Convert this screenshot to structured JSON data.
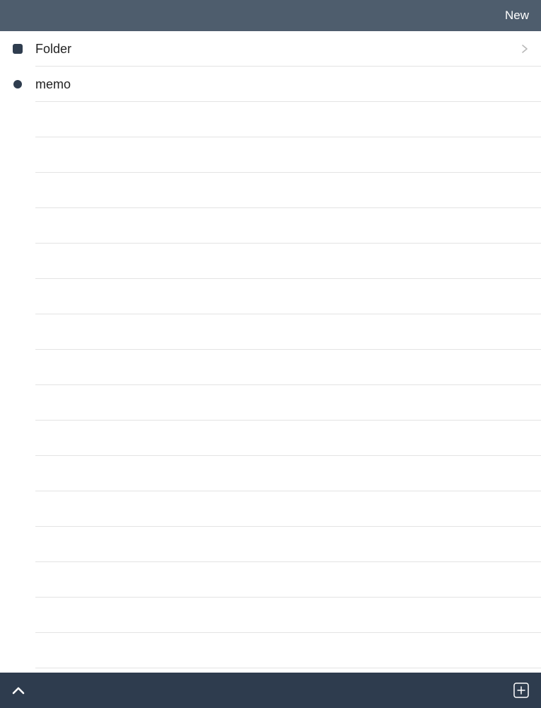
{
  "header": {
    "new_label": "New"
  },
  "items": [
    {
      "type": "folder",
      "label": "Folder",
      "icon": "folder-square-icon",
      "has_chevron": true
    },
    {
      "type": "memo",
      "label": "memo",
      "icon": "memo-dot-icon",
      "has_chevron": false
    }
  ],
  "toolbar": {
    "left_icon": "chevron-up-icon",
    "right_icon": "add-square-icon"
  },
  "colors": {
    "header_bg": "#4e5d6d",
    "toolbar_bg": "#2e3c4e",
    "icon_color": "#2f3d4f",
    "divider": "#e3e3e3"
  }
}
